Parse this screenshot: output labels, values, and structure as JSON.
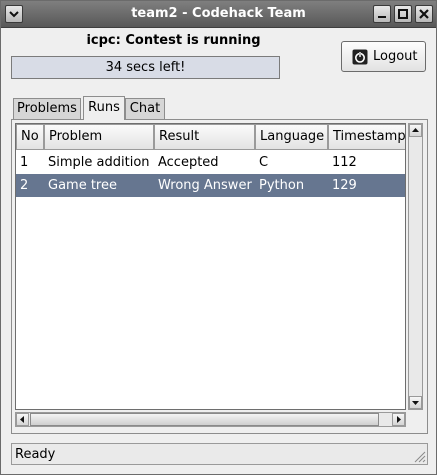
{
  "window": {
    "title": "team2 - Codehack Team"
  },
  "header": {
    "contest_status": "icpc: Contest is running",
    "time_left": "34 secs left!",
    "logout_label": "Logout"
  },
  "tabs": [
    {
      "label": "Problems"
    },
    {
      "label": "Runs"
    },
    {
      "label": "Chat"
    }
  ],
  "active_tab": "Runs",
  "runs_table": {
    "columns": [
      "No",
      "Problem",
      "Result",
      "Language",
      "Timestamp"
    ],
    "rows": [
      {
        "no": "1",
        "problem": "Simple addition",
        "result": "Accepted",
        "language": "C",
        "timestamp": "112",
        "selected": false
      },
      {
        "no": "2",
        "problem": "Game tree",
        "result": "Wrong Answer",
        "language": "Python",
        "timestamp": "129",
        "selected": true
      }
    ]
  },
  "statusbar": {
    "text": "Ready"
  },
  "colors": {
    "titlebar": "#6b6b6b",
    "selection": "#667690",
    "timebar": "#d8dce6"
  },
  "icons": [
    "window-menu-icon",
    "minimize-icon",
    "maximize-icon",
    "close-icon",
    "power-icon",
    "arrow-up-icon",
    "arrow-down-icon",
    "arrow-left-icon",
    "arrow-right-icon",
    "resize-grip-icon"
  ]
}
